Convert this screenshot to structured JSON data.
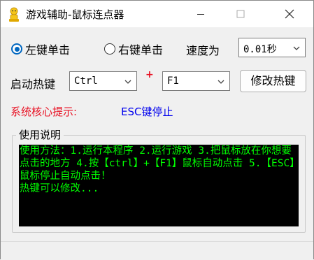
{
  "window": {
    "title": "游戏辅助-鼠标连点器"
  },
  "click_mode": {
    "options": [
      {
        "label": "左键单击",
        "selected": true
      },
      {
        "label": "右键单击",
        "selected": false
      }
    ]
  },
  "speed": {
    "label": "速度为",
    "value": "0.01秒"
  },
  "hotkey": {
    "label": "启动热键",
    "modifier_value": "Ctrl",
    "plus": "+",
    "key_value": "F1",
    "modify_button": "修改热键"
  },
  "hint": {
    "label": "系统核心提示:",
    "text": "ESC键停止"
  },
  "usage": {
    "group_label": "使用说明",
    "text": "使用方法：1.运行本程序 2.运行游戏 3.把鼠标放在你想要点击的地方 4.按【ctrl】+【F1】鼠标自动点击 5.【ESC】鼠标停止自动点击！\n热键可以修改..."
  },
  "colors": {
    "hint_red": "#e81123",
    "hint_blue": "#0000ee",
    "console_bg": "#000000",
    "console_text": "#00ff00",
    "radio_accent": "#0067c0"
  }
}
